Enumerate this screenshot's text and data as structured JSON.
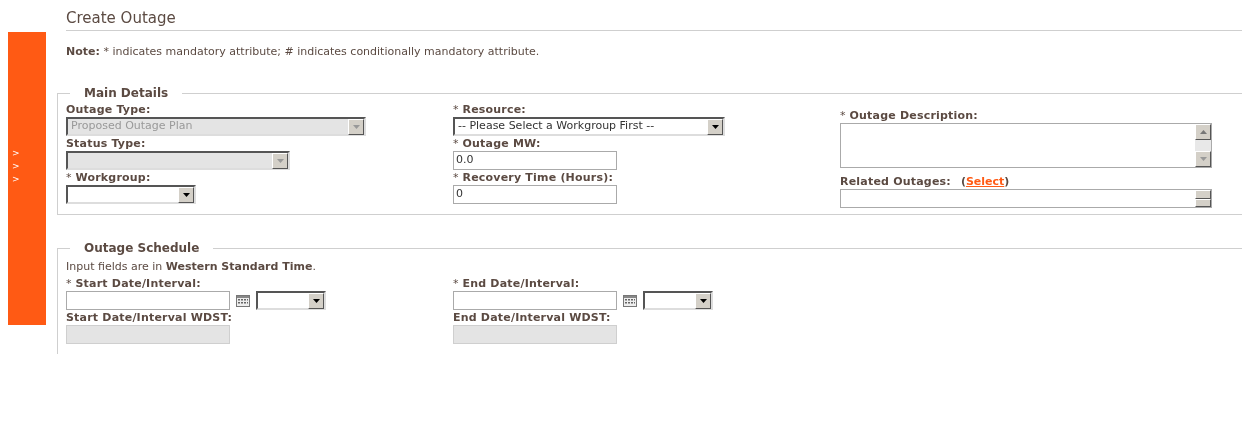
{
  "sidebar": {
    "arrows": [
      ">",
      ">",
      ">"
    ]
  },
  "title": "Create Outage",
  "note": "**Note:** * indicates mandatory attribute; # indicates conditionally mandatory attribute.",
  "main_details": {
    "legend": "Main Details",
    "columns": [
      [
        {
          "kind": "select",
          "label": "Outage Type:",
          "value": "Proposed Outage Plan",
          "disabled": true
        },
        {
          "kind": "select",
          "label": "Status Type:",
          "disabled": true
        },
        {
          "kind": "select",
          "required_mark": "*",
          "label": "Workgroup:",
          "disabled": false
        }
      ],
      [
        {
          "kind": "select",
          "required_mark": "*",
          "label": "Resource:",
          "value": "-- Please Select a Workgroup First --",
          "disabled": false
        },
        {
          "kind": "input",
          "required_mark": "*",
          "label": "Outage MW:",
          "value": "0.0",
          "disabled": false
        },
        {
          "kind": "input",
          "required_mark": "*",
          "label": "Recovery Time (Hours):",
          "value": "0",
          "disabled": false
        }
      ],
      [
        {
          "kind": "textarea",
          "required_mark": "*",
          "label": "Outage Description:",
          "disabled": false
        },
        {
          "kind": "listbox",
          "label": "Related Outages:",
          "link": {
            "before": "(",
            "text": "Select",
            "after": ")"
          },
          "disabled": false
        }
      ]
    ]
  },
  "outage_schedule": {
    "legend": "Outage Schedule",
    "note": "Input fields are in **Western Standard Time**.",
    "columns": [
      [
        {
          "kind": "date",
          "required_mark": "*",
          "label": "Start Date/Interval:",
          "disabled": false
        },
        {
          "kind": "input",
          "label": "Start Date/Interval WDST:",
          "disabled": true
        }
      ],
      [
        {
          "kind": "date",
          "required_mark": "*",
          "label": "End Date/Interval:",
          "disabled": false
        },
        {
          "kind": "input",
          "label": "End Date/Interval WDST:",
          "disabled": true
        }
      ]
    ]
  }
}
